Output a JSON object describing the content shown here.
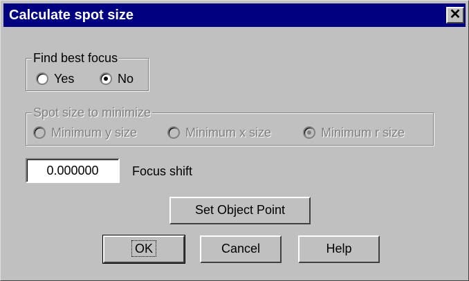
{
  "dialog": {
    "title": "Calculate spot size",
    "close_glyph": "✕"
  },
  "best_focus": {
    "legend": "Find best focus",
    "options": [
      {
        "label": "Yes",
        "checked": false
      },
      {
        "label": "No",
        "checked": true
      }
    ]
  },
  "spot_size": {
    "legend": "Spot size to minimize",
    "enabled": false,
    "options": [
      {
        "label": "Minimum y size",
        "checked": false
      },
      {
        "label": "Minimum x size",
        "checked": false
      },
      {
        "label": "Minimum r size",
        "checked": true
      }
    ]
  },
  "focus_shift": {
    "value": "0.000000",
    "label": "Focus shift"
  },
  "buttons": {
    "set_object_point": "Set Object Point",
    "ok": "OK",
    "cancel": "Cancel",
    "help": "Help"
  },
  "icons": {
    "close": "close-icon"
  }
}
